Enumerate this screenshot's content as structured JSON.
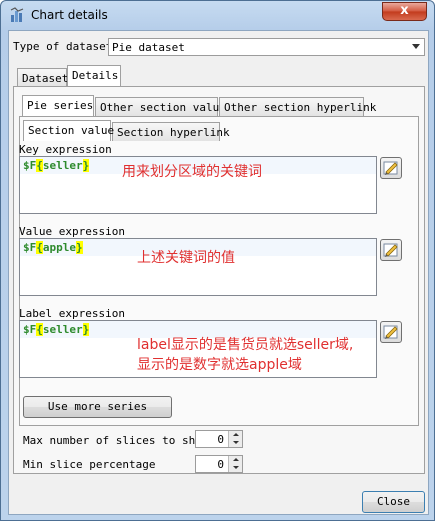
{
  "window": {
    "title": "Chart details",
    "close_label": "x"
  },
  "dataset_type": {
    "label": "Type of dataset",
    "value": "Pie dataset"
  },
  "main_tabs": [
    {
      "label": "Dataset",
      "active": false
    },
    {
      "label": "Details",
      "active": true
    }
  ],
  "pie_tabs": [
    {
      "label": "Pie series",
      "active": true
    },
    {
      "label": "Other section value",
      "active": false
    },
    {
      "label": "Other section hyperlink",
      "active": false
    }
  ],
  "section_tabs": [
    {
      "label": "Section value",
      "active": true
    },
    {
      "label": "Section hyperlink",
      "active": false
    }
  ],
  "key_expression": {
    "label": "Key expression",
    "code_prefix": "$F",
    "brace_open": "{",
    "field": "seller",
    "brace_close": "}",
    "note": "用来划分区域的关键词"
  },
  "value_expression": {
    "label": "Value expression",
    "code_prefix": "$F",
    "brace_open": "{",
    "field": "apple",
    "brace_close": "}",
    "note": "上述关键词的值"
  },
  "label_expression": {
    "label": "Label expression",
    "code_prefix": "$F",
    "brace_open": "{",
    "field": "seller",
    "brace_close": "}",
    "note_line1": "label显示的是售货员就选seller域,",
    "note_line2": "显示的是数字就选apple域"
  },
  "use_more_series_label": "Use more series",
  "max_slices": {
    "label": "Max number of slices to show",
    "value": "0"
  },
  "min_slice": {
    "label": "Min slice percentage",
    "value": "0"
  },
  "close_button_label": "Close",
  "icons": {
    "app": "chart-app-icon",
    "edit": "edit-expression-icon"
  }
}
